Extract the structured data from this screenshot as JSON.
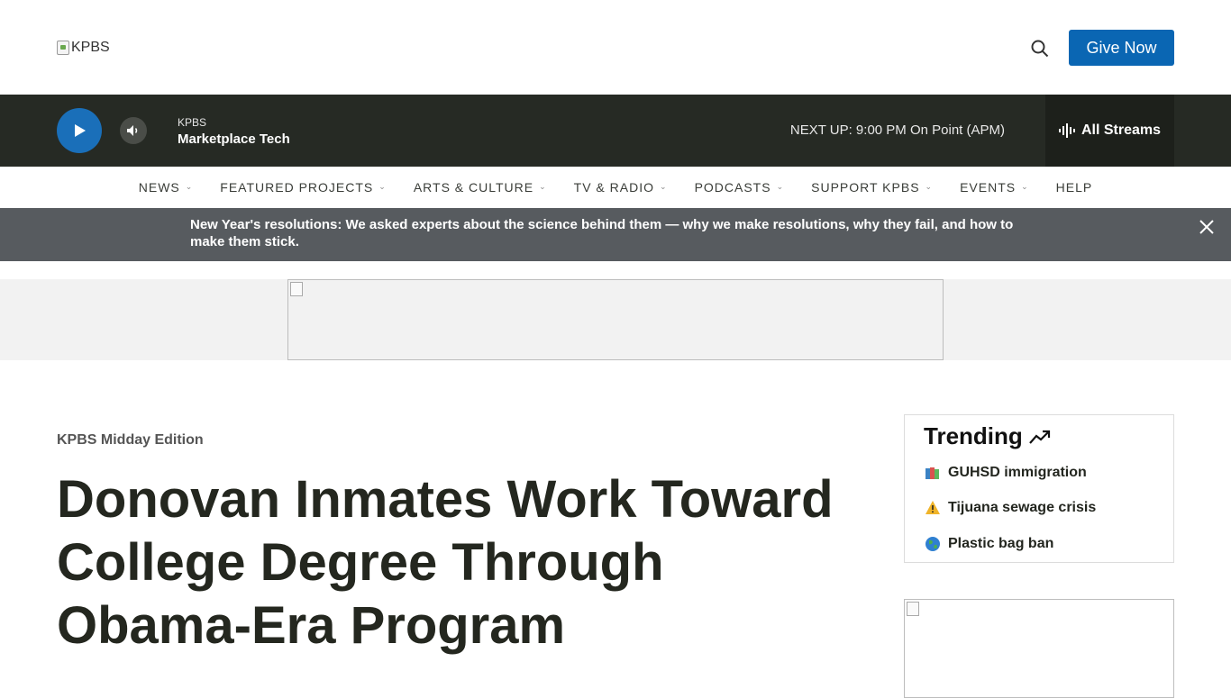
{
  "header": {
    "logo_alt": "KPBS",
    "give_label": "Give Now"
  },
  "player": {
    "station": "KPBS",
    "program": "Marketplace Tech",
    "next_up": "NEXT UP: 9:00 PM On Point (APM)",
    "streams_label": "All Streams"
  },
  "nav": {
    "items": [
      {
        "label": "NEWS"
      },
      {
        "label": "FEATURED PROJECTS"
      },
      {
        "label": "ARTS & CULTURE"
      },
      {
        "label": "TV & RADIO"
      },
      {
        "label": "PODCASTS"
      },
      {
        "label": "SUPPORT KPBS"
      },
      {
        "label": "EVENTS"
      },
      {
        "label": "HELP"
      }
    ]
  },
  "alert": {
    "text": "New Year's resolutions: We asked experts about the science behind them — why we make resolutions, why they fail, and how to make them stick."
  },
  "article": {
    "section": "KPBS Midday Edition",
    "headline": "Donovan Inmates Work Toward College Degree Through Obama-Era Program"
  },
  "trending": {
    "title": "Trending",
    "items": [
      {
        "icon": "books-icon",
        "label": "GUHSD immigration"
      },
      {
        "icon": "warning-icon",
        "label": "Tijuana sewage crisis"
      },
      {
        "icon": "globe-icon",
        "label": "Plastic bag ban"
      }
    ]
  },
  "colors": {
    "brand_blue": "#0a66b3",
    "player_bg": "#262a24",
    "alert_bg": "#575b5f"
  }
}
